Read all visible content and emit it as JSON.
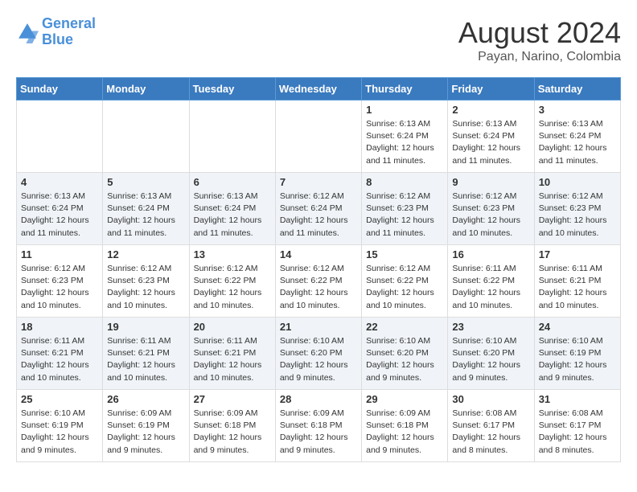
{
  "logo": {
    "line1": "General",
    "line2": "Blue"
  },
  "title": "August 2024",
  "subtitle": "Payan, Narino, Colombia",
  "days_of_week": [
    "Sunday",
    "Monday",
    "Tuesday",
    "Wednesday",
    "Thursday",
    "Friday",
    "Saturday"
  ],
  "weeks": [
    [
      {
        "day": "",
        "info": ""
      },
      {
        "day": "",
        "info": ""
      },
      {
        "day": "",
        "info": ""
      },
      {
        "day": "",
        "info": ""
      },
      {
        "day": "1",
        "info": "Sunrise: 6:13 AM\nSunset: 6:24 PM\nDaylight: 12 hours\nand 11 minutes."
      },
      {
        "day": "2",
        "info": "Sunrise: 6:13 AM\nSunset: 6:24 PM\nDaylight: 12 hours\nand 11 minutes."
      },
      {
        "day": "3",
        "info": "Sunrise: 6:13 AM\nSunset: 6:24 PM\nDaylight: 12 hours\nand 11 minutes."
      }
    ],
    [
      {
        "day": "4",
        "info": "Sunrise: 6:13 AM\nSunset: 6:24 PM\nDaylight: 12 hours\nand 11 minutes."
      },
      {
        "day": "5",
        "info": "Sunrise: 6:13 AM\nSunset: 6:24 PM\nDaylight: 12 hours\nand 11 minutes."
      },
      {
        "day": "6",
        "info": "Sunrise: 6:13 AM\nSunset: 6:24 PM\nDaylight: 12 hours\nand 11 minutes."
      },
      {
        "day": "7",
        "info": "Sunrise: 6:12 AM\nSunset: 6:24 PM\nDaylight: 12 hours\nand 11 minutes."
      },
      {
        "day": "8",
        "info": "Sunrise: 6:12 AM\nSunset: 6:23 PM\nDaylight: 12 hours\nand 11 minutes."
      },
      {
        "day": "9",
        "info": "Sunrise: 6:12 AM\nSunset: 6:23 PM\nDaylight: 12 hours\nand 10 minutes."
      },
      {
        "day": "10",
        "info": "Sunrise: 6:12 AM\nSunset: 6:23 PM\nDaylight: 12 hours\nand 10 minutes."
      }
    ],
    [
      {
        "day": "11",
        "info": "Sunrise: 6:12 AM\nSunset: 6:23 PM\nDaylight: 12 hours\nand 10 minutes."
      },
      {
        "day": "12",
        "info": "Sunrise: 6:12 AM\nSunset: 6:23 PM\nDaylight: 12 hours\nand 10 minutes."
      },
      {
        "day": "13",
        "info": "Sunrise: 6:12 AM\nSunset: 6:22 PM\nDaylight: 12 hours\nand 10 minutes."
      },
      {
        "day": "14",
        "info": "Sunrise: 6:12 AM\nSunset: 6:22 PM\nDaylight: 12 hours\nand 10 minutes."
      },
      {
        "day": "15",
        "info": "Sunrise: 6:12 AM\nSunset: 6:22 PM\nDaylight: 12 hours\nand 10 minutes."
      },
      {
        "day": "16",
        "info": "Sunrise: 6:11 AM\nSunset: 6:22 PM\nDaylight: 12 hours\nand 10 minutes."
      },
      {
        "day": "17",
        "info": "Sunrise: 6:11 AM\nSunset: 6:21 PM\nDaylight: 12 hours\nand 10 minutes."
      }
    ],
    [
      {
        "day": "18",
        "info": "Sunrise: 6:11 AM\nSunset: 6:21 PM\nDaylight: 12 hours\nand 10 minutes."
      },
      {
        "day": "19",
        "info": "Sunrise: 6:11 AM\nSunset: 6:21 PM\nDaylight: 12 hours\nand 10 minutes."
      },
      {
        "day": "20",
        "info": "Sunrise: 6:11 AM\nSunset: 6:21 PM\nDaylight: 12 hours\nand 10 minutes."
      },
      {
        "day": "21",
        "info": "Sunrise: 6:10 AM\nSunset: 6:20 PM\nDaylight: 12 hours\nand 9 minutes."
      },
      {
        "day": "22",
        "info": "Sunrise: 6:10 AM\nSunset: 6:20 PM\nDaylight: 12 hours\nand 9 minutes."
      },
      {
        "day": "23",
        "info": "Sunrise: 6:10 AM\nSunset: 6:20 PM\nDaylight: 12 hours\nand 9 minutes."
      },
      {
        "day": "24",
        "info": "Sunrise: 6:10 AM\nSunset: 6:19 PM\nDaylight: 12 hours\nand 9 minutes."
      }
    ],
    [
      {
        "day": "25",
        "info": "Sunrise: 6:10 AM\nSunset: 6:19 PM\nDaylight: 12 hours\nand 9 minutes."
      },
      {
        "day": "26",
        "info": "Sunrise: 6:09 AM\nSunset: 6:19 PM\nDaylight: 12 hours\nand 9 minutes."
      },
      {
        "day": "27",
        "info": "Sunrise: 6:09 AM\nSunset: 6:18 PM\nDaylight: 12 hours\nand 9 minutes."
      },
      {
        "day": "28",
        "info": "Sunrise: 6:09 AM\nSunset: 6:18 PM\nDaylight: 12 hours\nand 9 minutes."
      },
      {
        "day": "29",
        "info": "Sunrise: 6:09 AM\nSunset: 6:18 PM\nDaylight: 12 hours\nand 9 minutes."
      },
      {
        "day": "30",
        "info": "Sunrise: 6:08 AM\nSunset: 6:17 PM\nDaylight: 12 hours\nand 8 minutes."
      },
      {
        "day": "31",
        "info": "Sunrise: 6:08 AM\nSunset: 6:17 PM\nDaylight: 12 hours\nand 8 minutes."
      }
    ]
  ]
}
